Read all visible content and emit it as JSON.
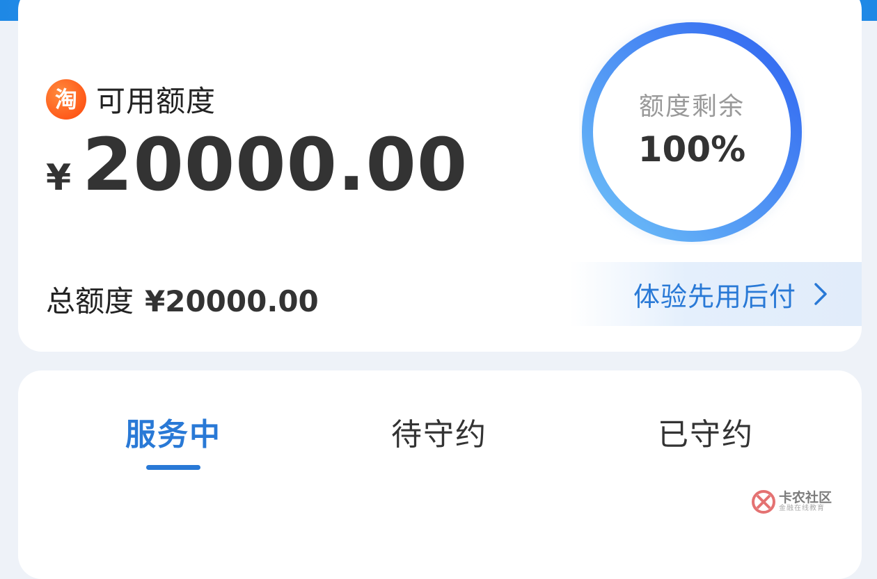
{
  "credit": {
    "logo_char": "淘",
    "available_label": "可用额度",
    "currency": "¥",
    "available_amount": "20000.00",
    "total_label": "总额度",
    "total_amount": "¥20000.00",
    "ring": {
      "label": "额度剩余",
      "value_text": "100%",
      "fraction": 1.0
    },
    "promo": {
      "text": "体验先用后付"
    }
  },
  "tabs": {
    "items": [
      {
        "label": "服务中",
        "active": true
      },
      {
        "label": "待守约",
        "active": false
      },
      {
        "label": "已守约",
        "active": false
      }
    ]
  },
  "watermark": {
    "title": "卡农社区",
    "subtitle": "金融在线教育"
  },
  "colors": {
    "accent": "#2979d6",
    "ring_start": "#64b5f6",
    "ring_end": "#2962ff",
    "logo": "#ff5a1a"
  }
}
